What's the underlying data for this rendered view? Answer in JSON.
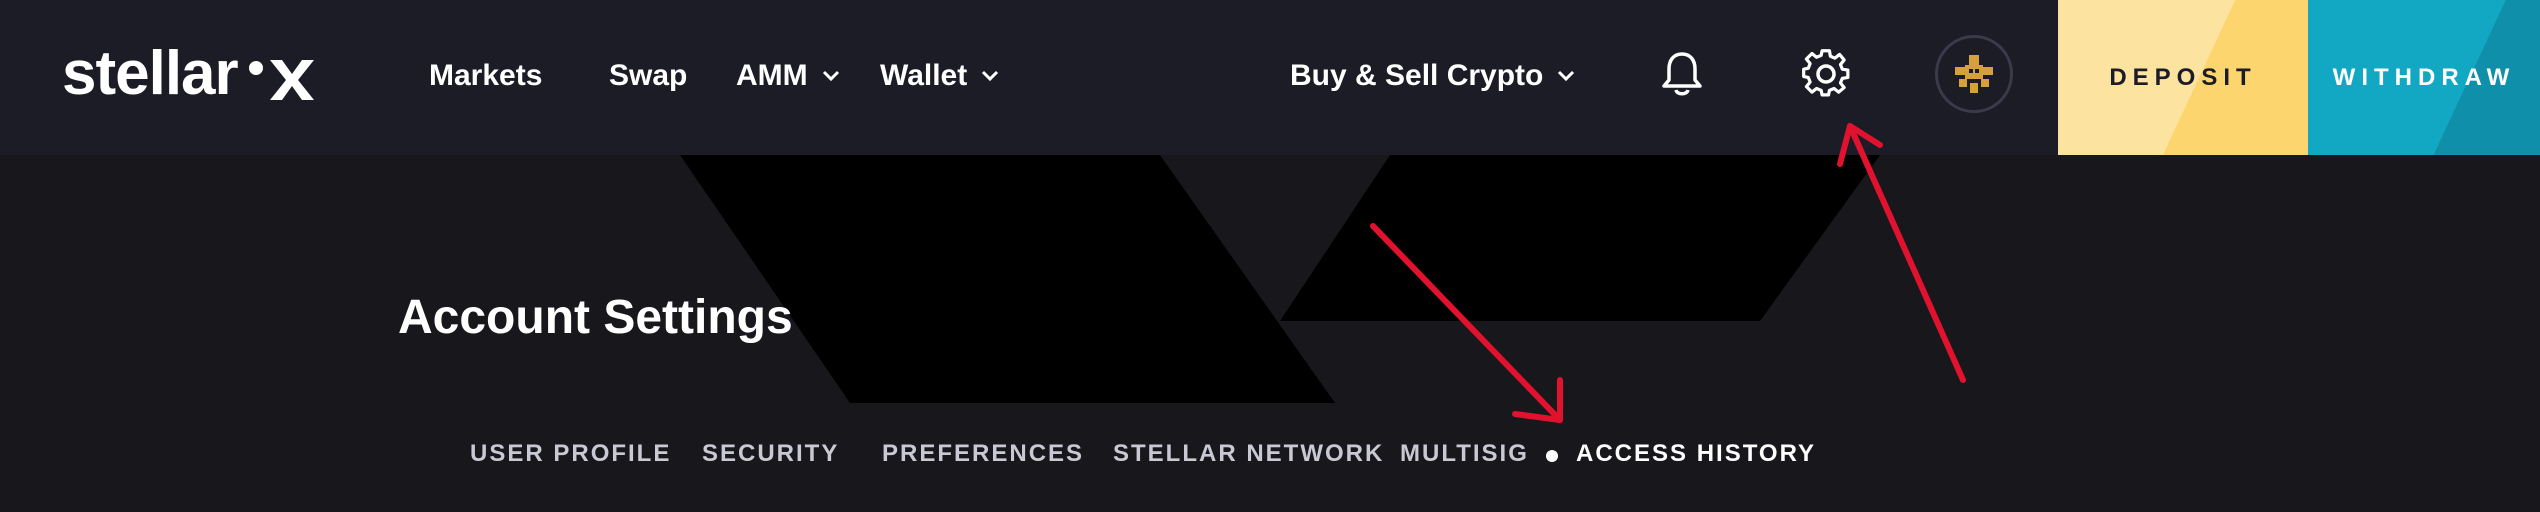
{
  "brand": {
    "logo_text": "stellar",
    "logo_letter": "x"
  },
  "nav": {
    "markets": "Markets",
    "swap": "Swap",
    "amm": "AMM",
    "wallet": "Wallet",
    "buy_sell": "Buy & Sell Crypto"
  },
  "actions": {
    "deposit": "DEPOSIT",
    "withdraw": "WITHDRAW"
  },
  "icons": {
    "notifications": "bell-icon",
    "settings": "gear-icon",
    "avatar": "identicon-avatar"
  },
  "page": {
    "title": "Account Settings"
  },
  "tabs": [
    {
      "label": "USER PROFILE"
    },
    {
      "label": "SECURITY"
    },
    {
      "label": "PREFERENCES"
    },
    {
      "label": "STELLAR NETWORK"
    },
    {
      "label": "MULTISIG"
    },
    {
      "label": "ACCESS HISTORY",
      "active": true
    }
  ],
  "colors": {
    "topbar": "#1c1c27",
    "background": "#18171c",
    "deposit": "#fddf8c",
    "withdraw": "#12a7c2",
    "annotation_arrow": "#e0122e",
    "avatar_accent": "#d6a13a"
  }
}
